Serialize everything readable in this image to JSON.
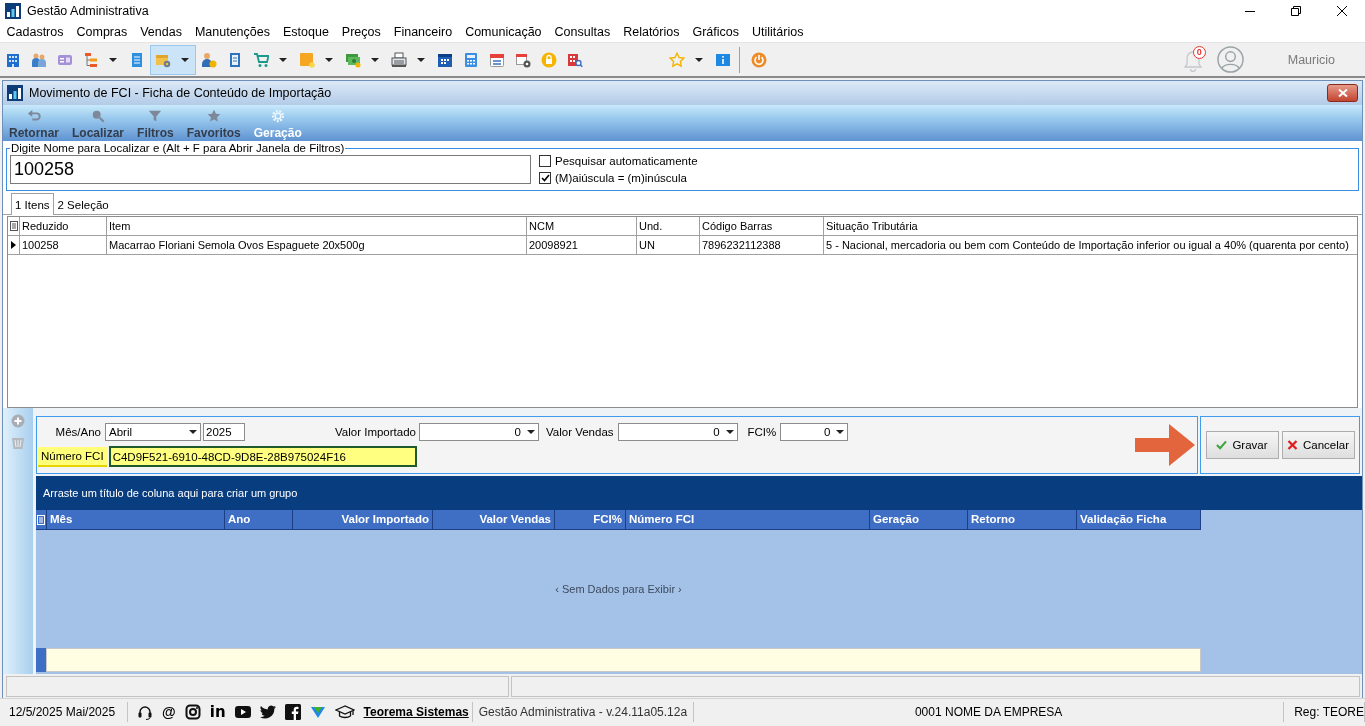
{
  "app": {
    "title": "Gestão Administrativa"
  },
  "menu": [
    "Cadastros",
    "Compras",
    "Vendas",
    "Manutenções",
    "Estoque",
    "Preços",
    "Financeiro",
    "Comunicação",
    "Consultas",
    "Relatórios",
    "Gráficos",
    "Utilitários"
  ],
  "toolbar": {
    "buttons": [
      {
        "dropdown": false,
        "selected": false
      },
      {
        "dropdown": false,
        "selected": false
      },
      {
        "dropdown": false,
        "selected": false
      },
      {
        "dropdown": true,
        "selected": false
      },
      {
        "dropdown": false,
        "selected": false
      },
      {
        "dropdown": true,
        "selected": true
      },
      {
        "dropdown": false,
        "selected": false
      },
      {
        "dropdown": false,
        "selected": false
      },
      {
        "dropdown": true,
        "selected": false
      },
      {
        "dropdown": true,
        "selected": false
      },
      {
        "dropdown": true,
        "selected": false
      },
      {
        "dropdown": true,
        "selected": false
      },
      {
        "dropdown": false,
        "selected": false
      },
      {
        "dropdown": false,
        "selected": false
      },
      {
        "dropdown": false,
        "selected": false
      },
      {
        "dropdown": false,
        "selected": false
      },
      {
        "dropdown": false,
        "selected": false
      },
      {
        "dropdown": false,
        "selected": false
      },
      {
        "dropdown": true,
        "selected": false
      },
      {
        "dropdown": false,
        "selected": false
      },
      {
        "dropdown": false,
        "selected": false
      }
    ],
    "notifications": {
      "count": "0"
    },
    "user": "Mauricio"
  },
  "window": {
    "title": "Movimento de FCI - Ficha de Conteúdo de Importação",
    "actions": [
      {
        "label": "Retornar",
        "disabled": true
      },
      {
        "label": "Localizar",
        "disabled": true
      },
      {
        "label": "Filtros",
        "disabled": true
      },
      {
        "label": "Favoritos",
        "disabled": true
      },
      {
        "label": "Geração",
        "disabled": false
      }
    ],
    "search": {
      "legend": "Digite Nome para Localizar e (Alt + F para Abrir Janela de Filtros)",
      "value": "100258",
      "options": [
        {
          "label": "Pesquisar automaticamente",
          "checked": false
        },
        {
          "label": "(M)aiúscula = (m)inúscula",
          "checked": true
        }
      ]
    },
    "tabs": [
      {
        "label": "1 Itens",
        "selected": true
      },
      {
        "label": "2 Seleção",
        "selected": false
      }
    ],
    "items_table": {
      "columns": [
        "Reduzido",
        "Item",
        "NCM",
        "Und.",
        "Código Barras",
        "Situação Tributária"
      ],
      "rows": [
        {
          "current": true,
          "cells": [
            "100258",
            "Macarrao Floriani Semola Ovos Espaguete 20x500g",
            "20098921",
            "UN",
            "7896232112388",
            "5 - Nacional, mercadoria ou bem com Conteúdo de Importação inferior ou igual a 40% (quarenta por cento)"
          ]
        }
      ]
    },
    "form": {
      "period": {
        "label": "Mês/Ano",
        "month": "Abril",
        "year": "2025"
      },
      "amounts": [
        {
          "label": "Valor Importado",
          "value": "0"
        },
        {
          "label": "Valor Vendas",
          "value": "0"
        },
        {
          "label": "FCI%",
          "value": "0"
        }
      ],
      "fci_number": {
        "label": "Número FCI",
        "value": "C4D9F521-6910-48CD-9D8E-28B975024F16",
        "focused": true
      }
    },
    "buttons": [
      {
        "label": "Gravar",
        "kind": "confirm"
      },
      {
        "label": "Cancelar",
        "kind": "cancel"
      }
    ],
    "history_table": {
      "group_hint": "Arraste um título de coluna aqui para criar um grupo",
      "columns": [
        {
          "label": "Mês",
          "kind": "text"
        },
        {
          "label": "Ano",
          "kind": "text"
        },
        {
          "label": "Valor Importado",
          "kind": "number"
        },
        {
          "label": "Valor Vendas",
          "kind": "number"
        },
        {
          "label": "FCI%",
          "kind": "number"
        },
        {
          "label": "Número FCI",
          "kind": "text"
        },
        {
          "label": "Geração",
          "kind": "text"
        },
        {
          "label": "Retorno",
          "kind": "text"
        },
        {
          "label": "Validação Ficha",
          "kind": "text"
        }
      ],
      "empty_text": "‹ Sem Dados para Exibir ›"
    }
  },
  "status_bar": {
    "date": "12/5/2025 Mai/2025",
    "at_symbol": "@",
    "in_symbol": "in",
    "link": "Teorema Sistemas",
    "version": "Gestão Administrativa - v.24.11a05.12a",
    "company": "0001 NOME DA EMPRESA",
    "registration": "Reg: TEORE"
  }
}
